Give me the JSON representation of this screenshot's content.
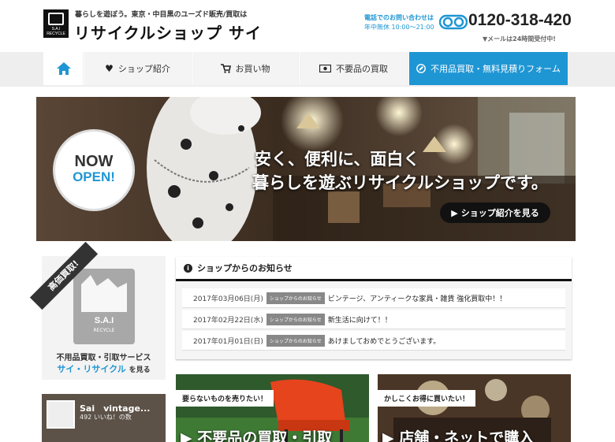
{
  "header": {
    "logo_text": "S.A.I RECYCLE",
    "tagline": "暮らしを遊ぼう。東京・中目黒のユーズド販売/買取は",
    "shop_name": "リサイクルショップ サイ",
    "contact_label": "電話でのお問い合わせは",
    "contact_hours": "年中無休 10:00～21:00",
    "phone": "0120-318-420",
    "mail_note": "▼メールは24時間受付中!"
  },
  "nav": {
    "home_icon": "home-icon",
    "shop": "ショップ紹介",
    "buy": "お買い物",
    "sell": "不要品の買取",
    "form": "不用品買取・無料見積りフォーム",
    "accent": "#1f96d4"
  },
  "hero": {
    "badge_now": "NOW",
    "badge_open": "OPEN!",
    "line1": "安く、便利に、面白く",
    "line2": "暮らしを遊ぶリサイクルショップです。",
    "button": "ショップ紹介を見る"
  },
  "sidebar": {
    "ribbon": "高価買取!",
    "logo_sai": "S.A.I",
    "logo_recycle": "RECYCLE",
    "text1": "不用品買取・引取サービス",
    "text2": "サイ・リサイクル",
    "text2_suffix": "を見る",
    "fb_name": "Sai　vintage...",
    "fb_likes": "492 いいね！の数"
  },
  "news": {
    "heading": "ショップからのお知らせ",
    "items": [
      {
        "date": "2017年03月06日(月)",
        "tag": "ショップからのお知らせ",
        "title": "ビンテージ、アンティークな家具・雑貨 強化買取中！！"
      },
      {
        "date": "2017年02月22日(水)",
        "tag": "ショップからのお知らせ",
        "title": "新生活に向けて！！"
      },
      {
        "date": "2017年01月01日(日)",
        "tag": "ショップからのお知らせ",
        "title": "あけましておめでとうございます。"
      }
    ]
  },
  "tiles": {
    "sell_label": "要らないものを売りたい！",
    "sell_big": "不要品の買取・引取",
    "buy_label": "かしこくお得に買いたい！",
    "buy_big": "店舗・ネットで購入"
  }
}
